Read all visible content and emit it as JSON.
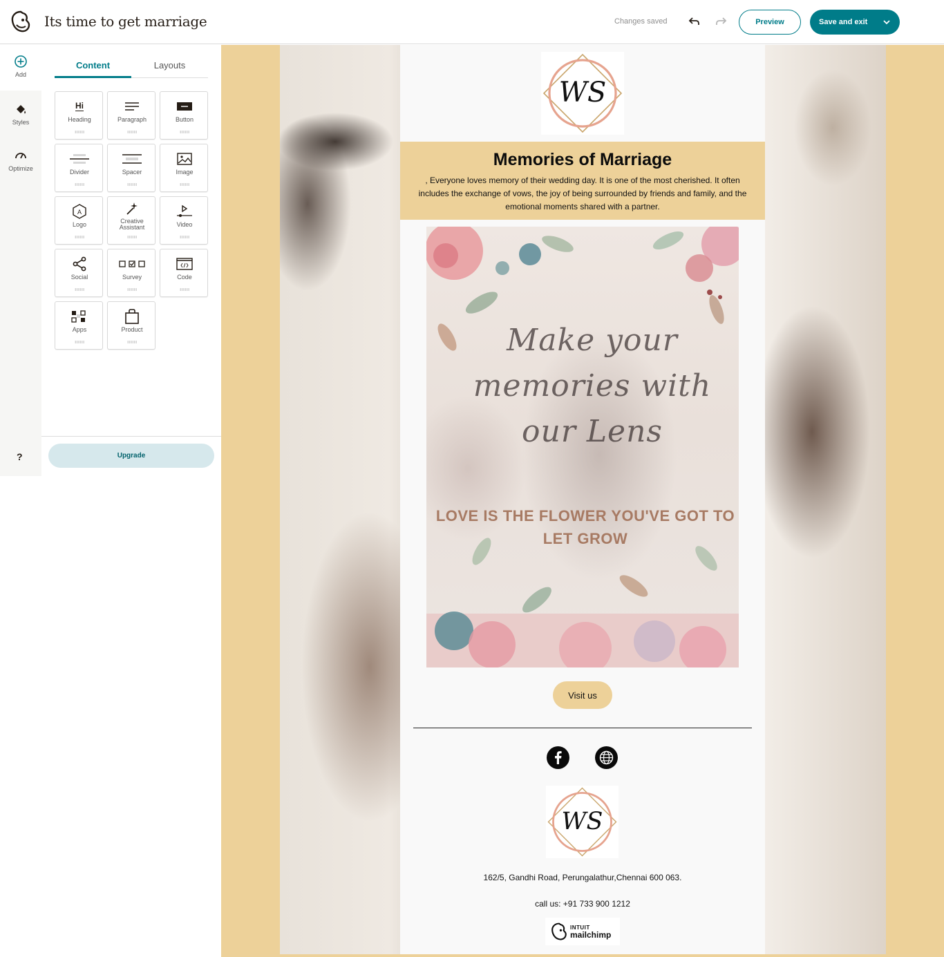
{
  "app": {
    "campaign_title": "Its time to get marriage",
    "status": "Changes saved",
    "preview_label": "Preview",
    "save_label": "Save and exit",
    "brand_color": "#007c89"
  },
  "rail": {
    "add_label": "Add",
    "styles_label": "Styles",
    "optimize_label": "Optimize",
    "help_label": "?"
  },
  "panel": {
    "tabs": [
      "Content",
      "Layouts"
    ],
    "blocks": [
      {
        "label": "Heading",
        "icon": "heading-icon"
      },
      {
        "label": "Paragraph",
        "icon": "paragraph-icon"
      },
      {
        "label": "Button",
        "icon": "button-icon"
      },
      {
        "label": "Divider",
        "icon": "divider-icon"
      },
      {
        "label": "Spacer",
        "icon": "spacer-icon"
      },
      {
        "label": "Image",
        "icon": "image-icon"
      },
      {
        "label": "Logo",
        "icon": "logo-icon"
      },
      {
        "label": "Creative Assistant",
        "icon": "magic-wand-icon"
      },
      {
        "label": "Video",
        "icon": "video-icon"
      },
      {
        "label": "Social",
        "icon": "share-icon"
      },
      {
        "label": "Survey",
        "icon": "survey-icon"
      },
      {
        "label": "Code",
        "icon": "code-icon"
      },
      {
        "label": "Apps",
        "icon": "apps-icon"
      },
      {
        "label": "Product",
        "icon": "bag-icon"
      }
    ],
    "heading_icon_text": "Hi",
    "upgrade_label": "Upgrade"
  },
  "email": {
    "monogram": "WS",
    "hero_title": "Memories of Marriage",
    "hero_text": ", Everyone loves memory of their wedding day. It is one of the most cherished. It often includes the exchange of vows, the joy of being surrounded by friends and family, and the emotional moments shared with a partner.",
    "poster_script": "Make your memories with our Lens",
    "poster_tagline": "LOVE IS THE FLOWER YOU'VE GOT TO LET GROW",
    "visit_label": "Visit us",
    "address": "162/5, Gandhi Road, Perungalathur,Chennai 600 063.",
    "phone": "call us: +91 733 900 1212",
    "badge_intuit": "INTUIT",
    "badge_name": "mailchimp",
    "accent_color": "#edd199"
  }
}
